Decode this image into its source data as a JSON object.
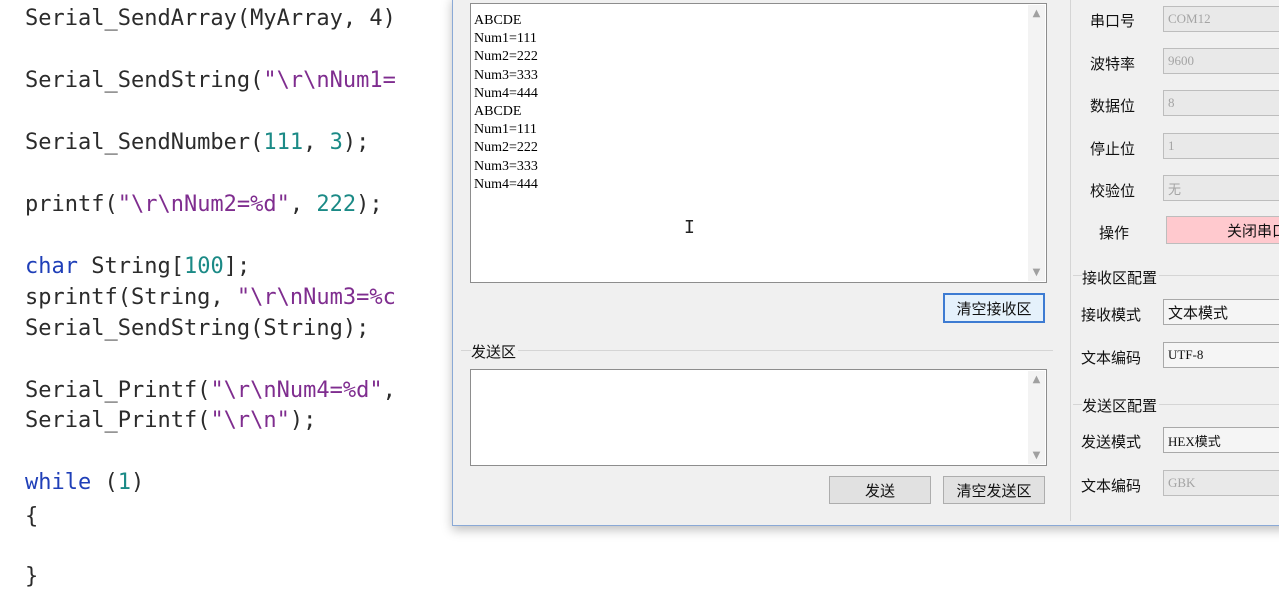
{
  "editor": {
    "lines": [
      "Serial_SendArray(MyArray, 4)",
      "Serial_SendString(\"\\r\\nNum1=",
      "Serial_SendNumber(111, 3);",
      "printf(\"\\r\\nNum2=%d\", 222);",
      "char String[100];",
      "sprintf(String, \"\\r\\nNum3=%c",
      "Serial_SendString(String);",
      "Serial_Printf(\"\\r\\nNum4=%d\",",
      "Serial_Printf(\"\\r\\n\");",
      "while (1)",
      "{",
      "}"
    ],
    "tokens": {
      "l0": "Serial_SendArray(MyArray, 4)",
      "l1a": "Serial_SendString(",
      "l1b": "\"\\r\\nNum1=",
      "l2a": "Serial_SendNumber(",
      "l2b": "111",
      "l2c": ", ",
      "l2d": "3",
      "l2e": ");",
      "l3a": "printf(",
      "l3b": "\"\\r\\nNum2=%d\"",
      "l3c": ", ",
      "l3d": "222",
      "l3e": ");",
      "l4a": "char",
      "l4b": " String[",
      "l4c": "100",
      "l4d": "];",
      "l5a": "sprintf(String, ",
      "l5b": "\"\\r\\nNum3=%c",
      "l6": "Serial_SendString(String);",
      "l7a": "Serial_Printf(",
      "l7b": "\"\\r\\nNum4=%d\"",
      "l7c": ",",
      "l8a": "Serial_Printf(",
      "l8b": "\"\\r\\n\"",
      "l8c": ");",
      "l9a": "while",
      "l9b": " (",
      "l9c": "1",
      "l9d": ")",
      "l10": "{",
      "l11": "}"
    }
  },
  "receive_area": {
    "text": "ABCDE\nNum1=111\nNum2=222\nNum3=333\nNum4=444\nABCDE\nNum1=111\nNum2=222\nNum3=333\nNum4=444",
    "clear_button": "清空接收区"
  },
  "send_area": {
    "group_label": "发送区",
    "text": "",
    "send_button": "发送",
    "clear_button": "清空发送区"
  },
  "port_settings": {
    "port": {
      "label": "串口号",
      "value": "COM12"
    },
    "baud": {
      "label": "波特率",
      "value": "9600"
    },
    "data": {
      "label": "数据位",
      "value": "8"
    },
    "stop": {
      "label": "停止位",
      "value": "1"
    },
    "parity": {
      "label": "校验位",
      "value": "无"
    },
    "action": {
      "label": "操作",
      "value": "关闭串口"
    }
  },
  "receive_config": {
    "group_label": "接收区配置",
    "mode": {
      "label": "接收模式",
      "value": "文本模式"
    },
    "encoding": {
      "label": "文本编码",
      "value": "UTF-8"
    }
  },
  "send_config": {
    "group_label": "发送区配置",
    "mode": {
      "label": "发送模式",
      "value": "HEX模式"
    },
    "encoding": {
      "label": "文本编码",
      "value": "GBK"
    }
  },
  "colors": {
    "keyword": "#1f3fb8",
    "string": "#7f2d8f",
    "number": "#1b8a86",
    "close_port_button": "#ffc9ce",
    "focus_border": "#3d7bd2"
  },
  "icons": {
    "scroll_up": "chevron-up-icon",
    "scroll_down": "chevron-down-icon",
    "text_cursor": "i-beam-cursor-icon"
  }
}
